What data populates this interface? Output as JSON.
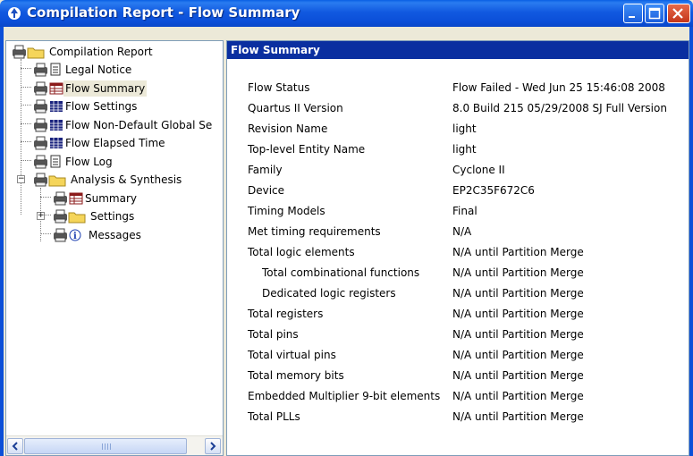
{
  "window": {
    "title": "Compilation Report - Flow Summary"
  },
  "tree": {
    "items": [
      {
        "label": "Compilation Report",
        "icon": "printer-folder-icon"
      },
      {
        "label": "Legal Notice",
        "icon": "printer-document-icon"
      },
      {
        "label": "Flow Summary",
        "icon": "printer-table-icon",
        "selected": true
      },
      {
        "label": "Flow Settings",
        "icon": "printer-table-icon"
      },
      {
        "label": "Flow Non-Default Global Se",
        "icon": "printer-table-icon"
      },
      {
        "label": "Flow Elapsed Time",
        "icon": "printer-table-icon"
      },
      {
        "label": "Flow Log",
        "icon": "printer-document-icon"
      },
      {
        "label": "Analysis & Synthesis",
        "icon": "printer-folder-icon"
      },
      {
        "label": "Summary",
        "icon": "printer-table-icon"
      },
      {
        "label": "Settings",
        "icon": "printer-folder-icon"
      },
      {
        "label": "Messages",
        "icon": "printer-info-icon"
      }
    ]
  },
  "main": {
    "header": "Flow Summary",
    "rows": [
      {
        "key": "Flow Status",
        "value": "Flow Failed - Wed Jun 25 15:46:08 2008"
      },
      {
        "key": "Quartus II Version",
        "value": "8.0 Build 215 05/29/2008 SJ Full Version"
      },
      {
        "key": "Revision Name",
        "value": "light"
      },
      {
        "key": "Top-level Entity Name",
        "value": "light"
      },
      {
        "key": "Family",
        "value": "Cyclone II"
      },
      {
        "key": "Device",
        "value": "EP2C35F672C6"
      },
      {
        "key": "Timing Models",
        "value": "Final"
      },
      {
        "key": "Met timing requirements",
        "value": "N/A"
      },
      {
        "key": "Total logic elements",
        "value": "N/A until Partition Merge"
      },
      {
        "key": "Total combinational functions",
        "value": "N/A until Partition Merge",
        "indent": true
      },
      {
        "key": "Dedicated logic registers",
        "value": "N/A until Partition Merge",
        "indent": true
      },
      {
        "key": "Total registers",
        "value": "N/A until Partition Merge"
      },
      {
        "key": "Total pins",
        "value": "N/A until Partition Merge"
      },
      {
        "key": "Total virtual pins",
        "value": "N/A until Partition Merge"
      },
      {
        "key": "Total memory bits",
        "value": "N/A until Partition Merge"
      },
      {
        "key": "Embedded Multiplier 9-bit elements",
        "value": "N/A until Partition Merge"
      },
      {
        "key": "Total PLLs",
        "value": "N/A until Partition Merge"
      }
    ]
  }
}
